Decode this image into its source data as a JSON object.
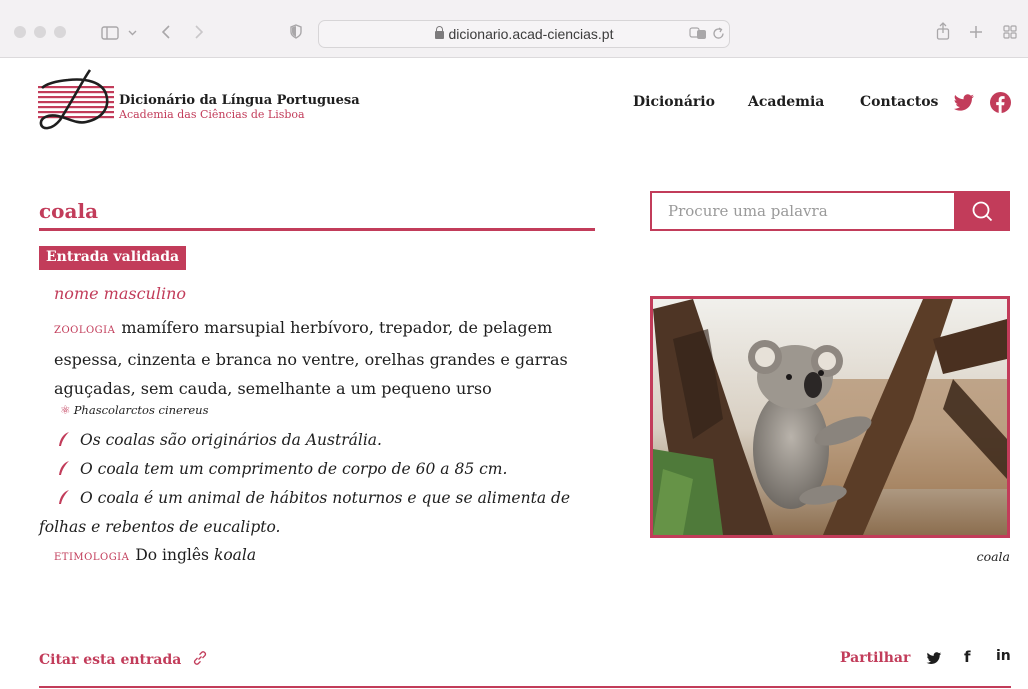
{
  "browser": {
    "url": "dicionario.acad-ciencias.pt"
  },
  "header": {
    "title": "Dicionário da Língua Portuguesa",
    "subtitle": "Academia das Ciências de Lisboa",
    "nav": [
      "Dicionário",
      "Academia",
      "Contactos"
    ],
    "social": [
      "twitter-icon",
      "facebook-icon"
    ]
  },
  "search": {
    "placeholder": "Procure uma palavra"
  },
  "entry": {
    "word": "coala",
    "status": "Entrada validada",
    "part_of_speech": "nome masculino",
    "domain": "ZOOLOGIA",
    "definition": "mamífero marsupial herbívoro, trepador, de pelagem espessa, cinzenta e branca no ventre, orelhas grandes e garras aguçadas, sem cauda, semelhante a um pequeno urso",
    "scientific_name": "Phascolarctos cinereus",
    "examples": [
      "Os coalas são originários da Austrália.",
      "O coala tem um comprimento de corpo de 60 a 85 cm.",
      "O coala é um animal de hábitos noturnos e que se alimenta de folhas e rebentos de eucalipto."
    ],
    "etymology_label": "ETIMOLOGIA",
    "etymology_text": "Do inglês",
    "etymology_word": "koala",
    "image_caption": "coala"
  },
  "actions": {
    "cite": "Citar esta entrada",
    "share": "Partilhar",
    "share_targets": [
      "twitter-icon",
      "facebook-icon",
      "linkedin-icon"
    ]
  },
  "colors": {
    "accent": "#c23c5a",
    "text": "#1e1e1e"
  }
}
